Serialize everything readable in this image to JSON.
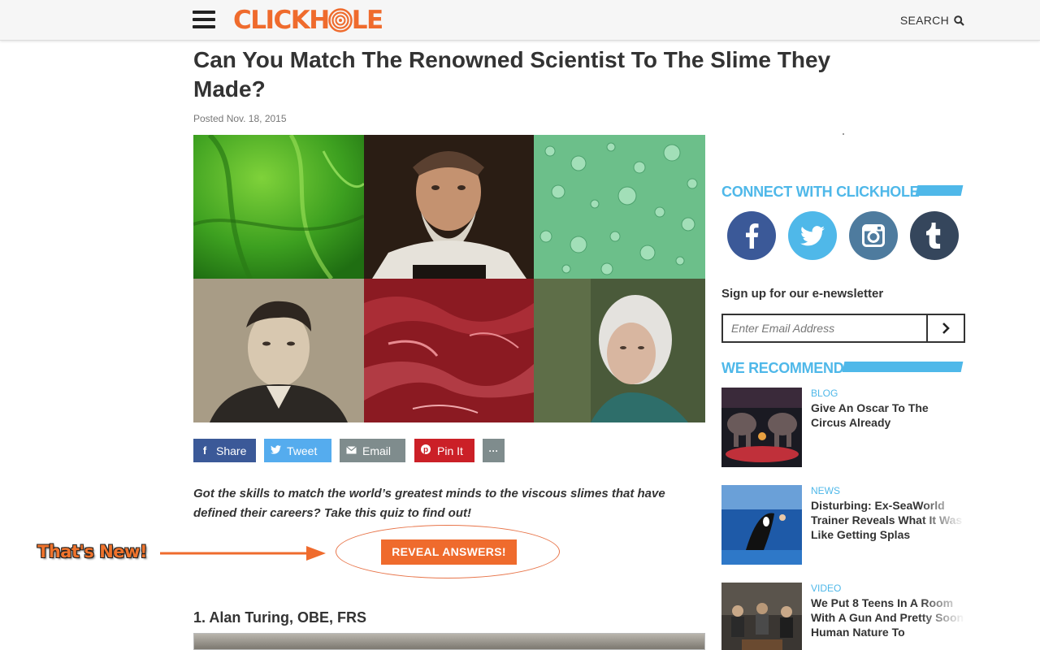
{
  "header": {
    "logo_text_left": "CLICKH",
    "logo_text_right": "LE",
    "search_label": "SEARCH"
  },
  "article": {
    "title": "Can You Match The Renowned Scientist To The Slime They Made?",
    "posted": "Posted Nov. 18, 2015",
    "share_buttons": [
      {
        "label": "Share",
        "icon": "facebook-icon"
      },
      {
        "label": "Tweet",
        "icon": "twitter-icon"
      },
      {
        "label": "Email",
        "icon": "envelope-icon"
      },
      {
        "label": "Pin It",
        "icon": "pinterest-icon"
      },
      {
        "label": "···",
        "icon": "more-icon"
      }
    ],
    "intro": "Got the skills to match the world’s greatest minds to the viscous slimes that have defined their careers? Take this quiz to find out!",
    "reveal_button": "REVEAL ANSWERS!",
    "question_1": "1. Alan Turing, OBE, FRS"
  },
  "annotation": {
    "text": "That's New!"
  },
  "sidebar": {
    "connect_heading": "CONNECT WITH CLICKHOLE",
    "social": [
      "facebook-icon",
      "twitter-icon",
      "instagram-icon",
      "tumblr-icon"
    ],
    "newsletter_label": "Sign up for our e-newsletter",
    "newsletter_placeholder": "Enter Email Address",
    "recommend_heading": "WE RECOMMEND",
    "recommendations": [
      {
        "category": "BLOG",
        "title": "Give An Oscar To The Circus Already"
      },
      {
        "category": "NEWS",
        "title": "Disturbing: Ex-SeaWorld Trainer Reveals What It Was Like Getting Splas"
      },
      {
        "category": "VIDEO",
        "title": "We Put 8 Teens In A Room With A Gun And Pretty Soon Human Nature To"
      }
    ]
  },
  "colors": {
    "brand_orange": "#ef6b2d",
    "accent_blue": "#4fb8e9",
    "facebook": "#3b5998",
    "twitter": "#55acee",
    "pinterest": "#cb2027"
  }
}
